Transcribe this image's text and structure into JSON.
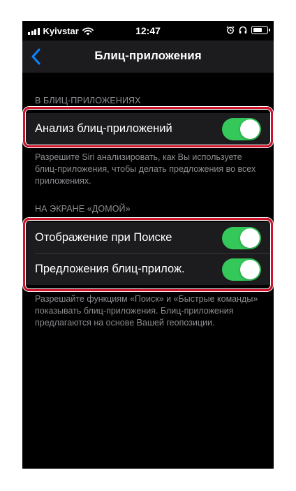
{
  "status_bar": {
    "carrier": "Kyivstar",
    "time": "12:47",
    "battery_level": 0.7
  },
  "nav": {
    "title": "Блиц-приложения"
  },
  "section1": {
    "header": "В БЛИЦ-ПРИЛОЖЕНИЯХ",
    "items": [
      {
        "label": "Анализ блиц-приложений",
        "enabled": true
      }
    ],
    "footer": "Разрешите Siri анализировать, как Вы используете блиц-приложения, чтобы делать предложения во всех приложениях."
  },
  "section2": {
    "header": "НА ЭКРАНЕ «ДОМОЙ»",
    "items": [
      {
        "label": "Отображение при Поиске",
        "enabled": true
      },
      {
        "label": "Предложения блиц-прилож.",
        "enabled": true
      }
    ],
    "footer": "Разрешайте функциям «Поиск» и «Быстрые команды» показывать блиц-приложения. Блиц-приложения предлагаются на основе Вашей геопозиции."
  },
  "colors": {
    "accent": "#0a84ff",
    "toggle_on": "#34c759",
    "highlight": "#d0132a"
  }
}
